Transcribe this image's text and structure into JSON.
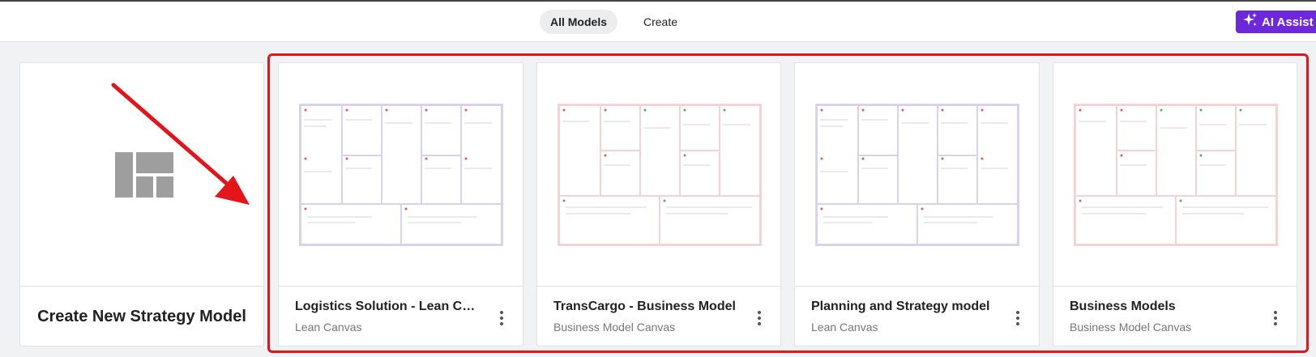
{
  "header": {
    "tabs": [
      {
        "label": "All Models",
        "active": true
      },
      {
        "label": "Create",
        "active": false
      }
    ],
    "ai_button": {
      "label": "AI Assist",
      "icon": "sparkle-icon",
      "color": "#6d28d9"
    }
  },
  "create_card": {
    "label": "Create New Strategy Model",
    "icon": "layout-template-icon"
  },
  "models": [
    {
      "title": "Logistics Solution - Lean Canvas",
      "type": "Lean Canvas"
    },
    {
      "title": "TransCargo - Business Model",
      "type": "Business Model Canvas"
    },
    {
      "title": "Planning and Strategy model",
      "type": "Lean Canvas"
    },
    {
      "title": "Business Models",
      "type": "Business Model Canvas"
    }
  ],
  "colors": {
    "lean_canvas_border": "#d8d2ee",
    "business_canvas_border": "#f5d2d4",
    "highlight": "#e4141b",
    "arrow": "#e4141b"
  }
}
